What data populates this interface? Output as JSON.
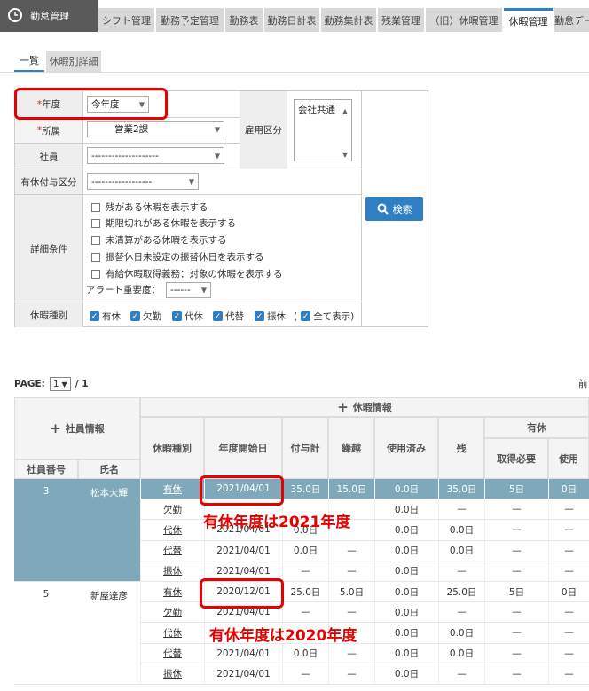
{
  "header": {
    "brand": "勤怠管理",
    "tabs": [
      "シフト管理",
      "勤務予定管理",
      "勤務表",
      "勤務日計表",
      "勤務集計表",
      "残業管理",
      "（旧）休暇管理",
      "休暇管理",
      "勤怠デー"
    ]
  },
  "subtabs": [
    "一覧",
    "休暇別詳細"
  ],
  "form": {
    "nendo_label": "年度",
    "nendo_value": "今年度",
    "shozoku_label": "所属",
    "shozoku_value": "営業2課",
    "shain_label": "社員",
    "shain_value": "--------------------",
    "koyo_label": "雇用区分",
    "koyo_value": "会社共通",
    "yukyu_label": "有休付与区分",
    "yukyu_value": "------------------",
    "detail_label": "詳細条件",
    "options": [
      "残がある休暇を表示する",
      "期限切れがある休暇を表示する",
      "未清算がある休暇を表示する",
      "振替休日未設定の振替休日を表示する",
      "有給休暇取得義務：対象の休暇を表示する"
    ],
    "alert_label": "アラート重要度：",
    "alert_value": "------",
    "kind_label": "休暇種別",
    "kinds": [
      "有休",
      "欠勤",
      "代休",
      "代替",
      "振休"
    ],
    "all_label": "全て表示",
    "search_label": "検索"
  },
  "pagination": {
    "label": "PAGE:",
    "value": "1",
    "total": "/ 1",
    "prev": "前"
  },
  "table": {
    "group_emp": "社員情報",
    "group_leave": "休暇情報",
    "group_yukyu": "有休",
    "headers": {
      "emp_no": "社員番号",
      "name": "氏名",
      "kind": "休暇種別",
      "start": "年度開始日",
      "grant": "付与計",
      "carry": "繰越",
      "used": "使用済み",
      "remain": "残",
      "need": "取得必要",
      "use": "使用"
    },
    "employees": [
      {
        "no": "3",
        "name": "松本大輝",
        "rows": [
          {
            "kind": "有休",
            "start": "2021/04/01",
            "grant": "35.0日",
            "carry": "15.0日",
            "used": "0.0日",
            "remain": "35.0日",
            "need": "5日",
            "use": "0日"
          },
          {
            "kind": "欠勤",
            "start": "",
            "grant": "",
            "carry": "",
            "used": "0.0日",
            "remain": "—",
            "need": "—",
            "use": "—"
          },
          {
            "kind": "代休",
            "start": "2021/04/01",
            "grant": "0.0日",
            "carry": "",
            "used": "0.0日",
            "remain": "0.0日",
            "need": "—",
            "use": "—"
          },
          {
            "kind": "代替",
            "start": "2021/04/01",
            "grant": "0.0日",
            "carry": "—",
            "used": "0.0日",
            "remain": "0.0日",
            "need": "—",
            "use": "—"
          },
          {
            "kind": "振休",
            "start": "2021/04/01",
            "grant": "—",
            "carry": "—",
            "used": "0.0日",
            "remain": "—",
            "need": "—",
            "use": "—"
          }
        ]
      },
      {
        "no": "5",
        "name": "新屋達彦",
        "rows": [
          {
            "kind": "有休",
            "start": "2020/12/01",
            "grant": "25.0日",
            "carry": "5.0日",
            "used": "0.0日",
            "remain": "25.0日",
            "need": "5日",
            "use": "0日"
          },
          {
            "kind": "欠勤",
            "start": "2021/04/01",
            "grant": "—",
            "carry": "—",
            "used": "0.0日",
            "remain": "—",
            "need": "—",
            "use": "—"
          },
          {
            "kind": "代休",
            "start": "",
            "grant": "",
            "carry": "",
            "used": "0.0日",
            "remain": "0.0日",
            "need": "—",
            "use": "—"
          },
          {
            "kind": "代替",
            "start": "2021/04/01",
            "grant": "0.0日",
            "carry": "—",
            "used": "0.0日",
            "remain": "0.0日",
            "need": "—",
            "use": "—"
          },
          {
            "kind": "振休",
            "start": "2021/04/01",
            "grant": "—",
            "carry": "—",
            "used": "0.0日",
            "remain": "—",
            "need": "—",
            "use": "—"
          }
        ]
      }
    ]
  },
  "annotations": [
    "有休年度は2021年度",
    "有休年度は2020年度"
  ]
}
